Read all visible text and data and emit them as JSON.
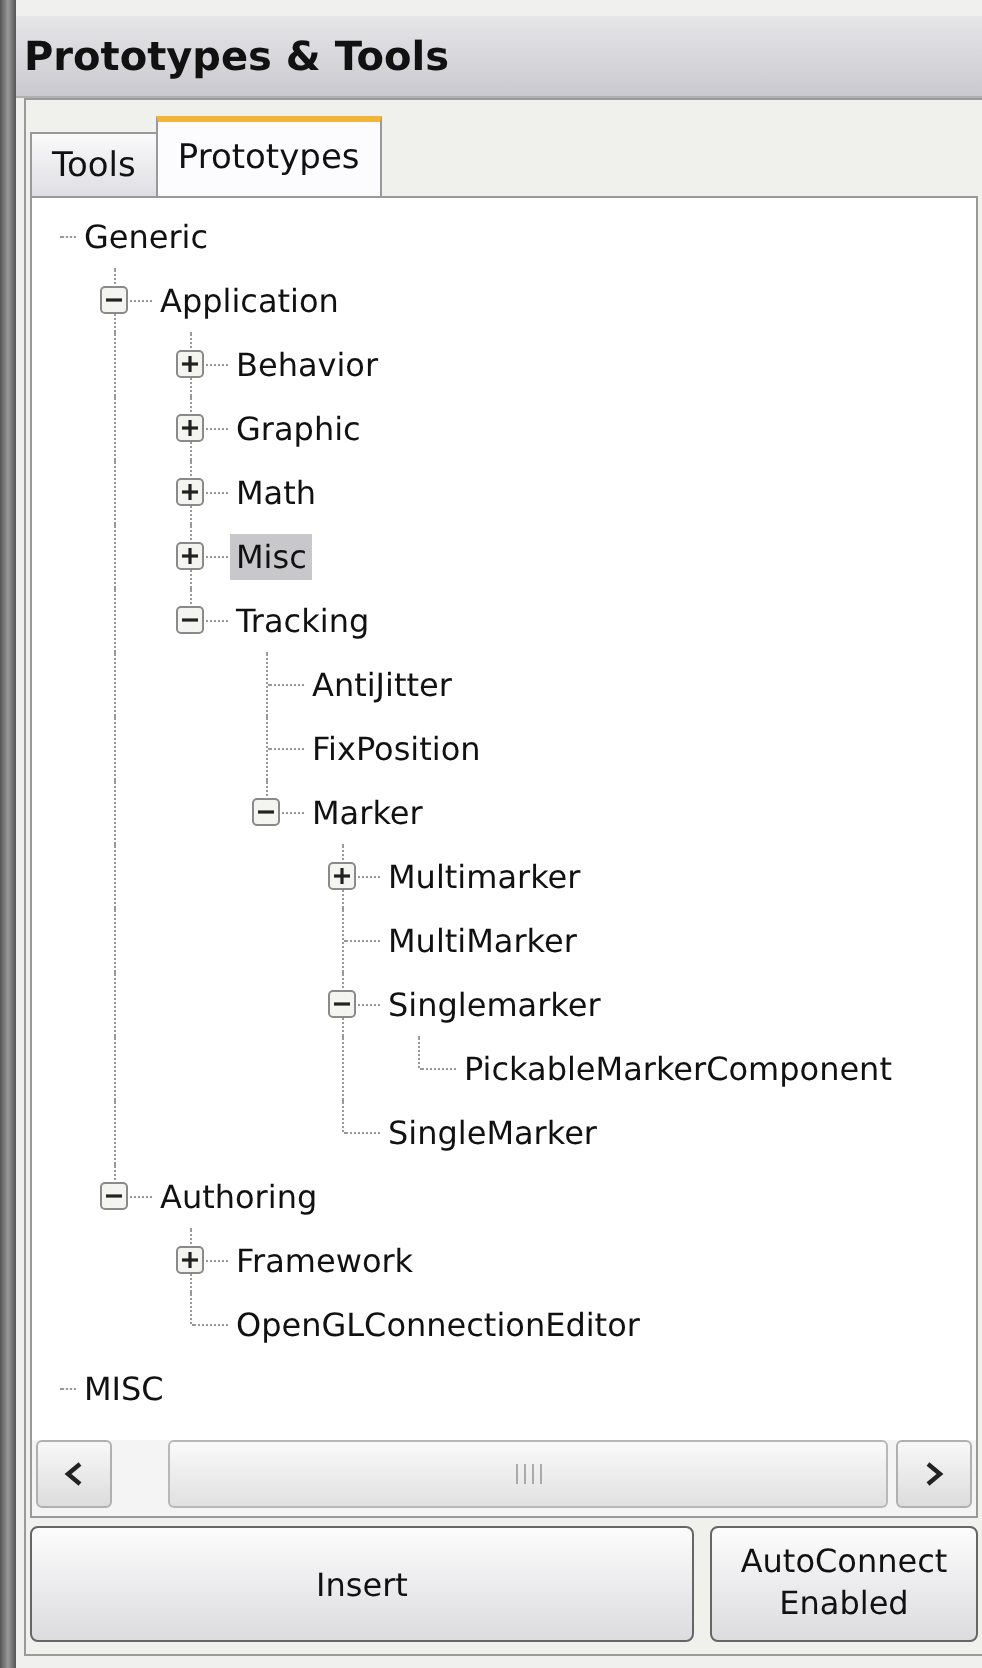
{
  "title": "Prototypes & Tools",
  "tabs": [
    {
      "label": "Tools",
      "selected": false
    },
    {
      "label": "Prototypes",
      "selected": true
    }
  ],
  "tree": [
    {
      "label": "Generic",
      "selected": false,
      "children": [
        {
          "label": "Application",
          "selected": false,
          "expanded": true,
          "children": [
            {
              "label": "Behavior",
              "selected": false,
              "expanded": false
            },
            {
              "label": "Graphic",
              "selected": false,
              "expanded": false
            },
            {
              "label": "Math",
              "selected": false,
              "expanded": false
            },
            {
              "label": "Misc",
              "selected": true,
              "expanded": false
            },
            {
              "label": "Tracking",
              "selected": false,
              "expanded": true,
              "children": [
                {
                  "label": "AntiJitter",
                  "selected": false
                },
                {
                  "label": "FixPosition",
                  "selected": false
                },
                {
                  "label": "Marker",
                  "selected": false,
                  "expanded": true,
                  "children": [
                    {
                      "label": "Multimarker",
                      "selected": false,
                      "expanded": false
                    },
                    {
                      "label": "MultiMarker",
                      "selected": false
                    },
                    {
                      "label": "Singlemarker",
                      "selected": false,
                      "expanded": true,
                      "children": [
                        {
                          "label": "PickableMarkerComponent",
                          "selected": false
                        }
                      ]
                    },
                    {
                      "label": "SingleMarker",
                      "selected": false
                    }
                  ]
                }
              ]
            }
          ]
        },
        {
          "label": "Authoring",
          "selected": false,
          "expanded": true,
          "children": [
            {
              "label": "Framework",
              "selected": false,
              "expanded": false
            },
            {
              "label": "OpenGLConnectionEditor",
              "selected": false
            }
          ]
        }
      ]
    },
    {
      "label": "MISC",
      "selected": false
    }
  ],
  "buttons": [
    {
      "label": "Insert"
    },
    {
      "label": "AutoConnect Enabled"
    }
  ]
}
